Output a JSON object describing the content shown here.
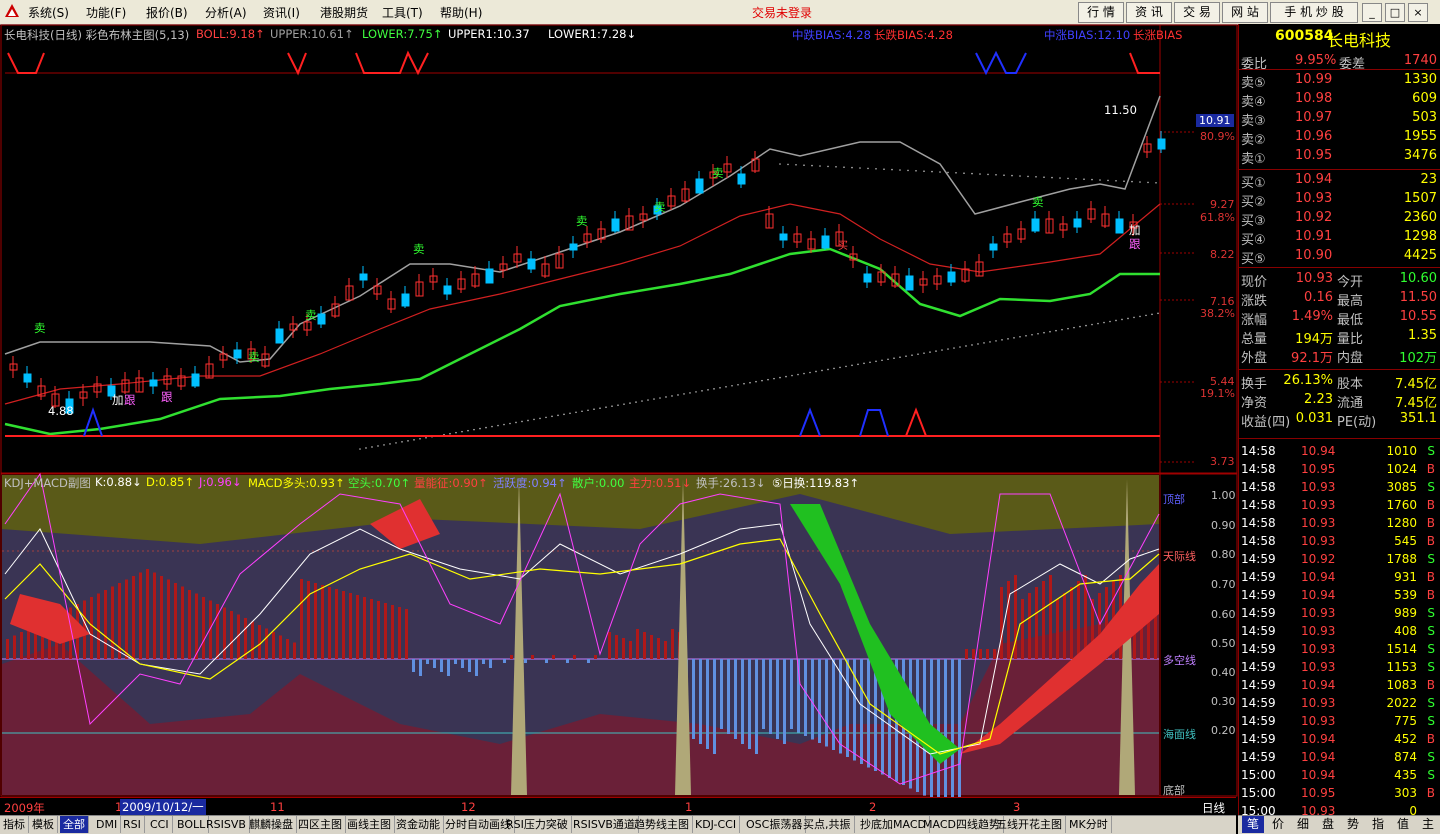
{
  "menu": {
    "items": [
      "系统(S)",
      "功能(F)",
      "报价(B)",
      "分析(A)",
      "资讯(I)",
      "港股期货",
      "工具(T)",
      "帮助(H)"
    ],
    "status": "交易未登录",
    "toolbar": [
      "行 情",
      "资 讯",
      "交 易",
      "网 站",
      "手 机 炒 股"
    ],
    "window_buttons": [
      "_",
      "□",
      "×"
    ]
  },
  "main_chart": {
    "header": [
      {
        "text": "长电科技(日线) 彩色布林主图(5,13)",
        "color": "#c0c0c0"
      },
      {
        "text": "BOLL:9.18↑",
        "color": "#ff4040"
      },
      {
        "text": "UPPER:10.61↑",
        "color": "#a0a0a0"
      },
      {
        "text": "LOWER:7.75↑",
        "color": "#40ff40"
      },
      {
        "text": "UPPER1:10.37",
        "color": "#ffffff"
      },
      {
        "text": "LOWER1:7.28↓",
        "color": "#ffffff"
      }
    ],
    "top_labels": [
      {
        "text": "中跌BIAS:4.28",
        "color": "#4040ff"
      },
      {
        "text": "长跌BIAS:4.28",
        "color": "#ff3030"
      },
      {
        "text": "中涨BIAS:12.10",
        "color": "#4040ff"
      },
      {
        "text": "长涨BIAS",
        "color": "#ff3030"
      }
    ],
    "price_axis": [
      "10.91",
      "80.9%",
      "9.27",
      "61.8%",
      "8.22",
      "7.16",
      "38.2%",
      "5.44",
      "19.1%",
      "3.73"
    ],
    "annotations": {
      "high": "11.50",
      "low": "4.88"
    },
    "signals": [
      "卖",
      "卖",
      "卖",
      "卖",
      "卖",
      "卖",
      "卖",
      "卖",
      "加",
      "跟",
      "跟",
      "加",
      "跟",
      "买"
    ]
  },
  "sub_chart": {
    "header": [
      {
        "text": "KDJ+MACD副图",
        "color": "#c0c0c0"
      },
      {
        "text": "K:0.88↓",
        "color": "#ffffff"
      },
      {
        "text": "D:0.85↑",
        "color": "#ffff00"
      },
      {
        "text": "J:0.96↓",
        "color": "#ff40ff"
      },
      {
        "text": "MACD多头:0.93↑",
        "color": "#ffff00"
      },
      {
        "text": "空头:0.70↑",
        "color": "#40ff40"
      },
      {
        "text": "量能征:0.90↑",
        "color": "#ff4040"
      },
      {
        "text": "活跃度:0.94↑",
        "color": "#8080ff"
      },
      {
        "text": "散户:0.00",
        "color": "#40ff40"
      },
      {
        "text": "主力:0.51↓",
        "color": "#ff4040"
      },
      {
        "text": "换手:26.13↓",
        "color": "#c0c0c0"
      },
      {
        "text": "⑤日换:119.83↑",
        "color": "#ffffff"
      }
    ],
    "axis": [
      "1.00",
      "0.90",
      "0.80",
      "0.70",
      "0.60",
      "0.50",
      "0.40",
      "0.30",
      "0.20"
    ],
    "zone_labels": [
      "顶部",
      "天际线",
      "多空线",
      "海面线",
      "底部"
    ]
  },
  "date_axis": {
    "labels": [
      "2009年",
      "1",
      "2009/10/12/一",
      "11",
      "12",
      "1",
      "2",
      "3"
    ],
    "period": "日线"
  },
  "quote": {
    "code": "600584",
    "name": "长电科技",
    "weibi": {
      "label": "委比",
      "value": "9.95%",
      "label2": "委差",
      "value2": "1740"
    },
    "asks": [
      {
        "label": "卖⑤",
        "price": "10.99",
        "vol": "1330"
      },
      {
        "label": "卖④",
        "price": "10.98",
        "vol": "609"
      },
      {
        "label": "卖③",
        "price": "10.97",
        "vol": "503"
      },
      {
        "label": "卖②",
        "price": "10.96",
        "vol": "1955"
      },
      {
        "label": "卖①",
        "price": "10.95",
        "vol": "3476"
      }
    ],
    "bids": [
      {
        "label": "买①",
        "price": "10.94",
        "vol": "23"
      },
      {
        "label": "买②",
        "price": "10.93",
        "vol": "1507"
      },
      {
        "label": "买③",
        "price": "10.92",
        "vol": "2360"
      },
      {
        "label": "买④",
        "price": "10.91",
        "vol": "1298"
      },
      {
        "label": "买⑤",
        "price": "10.90",
        "vol": "4425"
      }
    ],
    "stats1": [
      {
        "l1": "现价",
        "v1": "10.93",
        "l2": "今开",
        "v2": "10.60"
      },
      {
        "l1": "涨跌",
        "v1": "0.16",
        "l2": "最高",
        "v2": "11.50"
      },
      {
        "l1": "涨幅",
        "v1": "1.49%",
        "l2": "最低",
        "v2": "10.55"
      },
      {
        "l1": "总量",
        "v1": "194万",
        "l2": "量比",
        "v2": "1.35"
      },
      {
        "l1": "外盘",
        "v1": "92.1万",
        "l2": "内盘",
        "v2": "102万"
      }
    ],
    "stats2": [
      {
        "l1": "换手",
        "v1": "26.13%",
        "l2": "股本",
        "v2": "7.45亿"
      },
      {
        "l1": "净资",
        "v1": "2.23",
        "l2": "流通",
        "v2": "7.45亿"
      },
      {
        "l1": "收益(四)",
        "v1": "0.031",
        "l2": "PE(动)",
        "v2": "351.1"
      }
    ],
    "trades": [
      {
        "time": "14:58",
        "price": "10.94",
        "vol": "1010",
        "side": "S"
      },
      {
        "time": "14:58",
        "price": "10.95",
        "vol": "1024",
        "side": "B"
      },
      {
        "time": "14:58",
        "price": "10.93",
        "vol": "3085",
        "side": "S"
      },
      {
        "time": "14:58",
        "price": "10.93",
        "vol": "1760",
        "side": "B"
      },
      {
        "time": "14:58",
        "price": "10.93",
        "vol": "1280",
        "side": "B"
      },
      {
        "time": "14:58",
        "price": "10.93",
        "vol": "545",
        "side": "B"
      },
      {
        "time": "14:59",
        "price": "10.92",
        "vol": "1788",
        "side": "S"
      },
      {
        "time": "14:59",
        "price": "10.94",
        "vol": "931",
        "side": "B"
      },
      {
        "time": "14:59",
        "price": "10.94",
        "vol": "539",
        "side": "B"
      },
      {
        "time": "14:59",
        "price": "10.93",
        "vol": "989",
        "side": "S"
      },
      {
        "time": "14:59",
        "price": "10.93",
        "vol": "408",
        "side": "S"
      },
      {
        "time": "14:59",
        "price": "10.93",
        "vol": "1514",
        "side": "S"
      },
      {
        "time": "14:59",
        "price": "10.93",
        "vol": "1153",
        "side": "S"
      },
      {
        "time": "14:59",
        "price": "10.94",
        "vol": "1083",
        "side": "B"
      },
      {
        "time": "14:59",
        "price": "10.93",
        "vol": "2022",
        "side": "S"
      },
      {
        "time": "14:59",
        "price": "10.93",
        "vol": "775",
        "side": "S"
      },
      {
        "time": "14:59",
        "price": "10.94",
        "vol": "452",
        "side": "B"
      },
      {
        "time": "14:59",
        "price": "10.94",
        "vol": "874",
        "side": "S"
      },
      {
        "time": "15:00",
        "price": "10.94",
        "vol": "435",
        "side": "S"
      },
      {
        "time": "15:00",
        "price": "10.95",
        "vol": "303",
        "side": "B"
      },
      {
        "time": "15:00",
        "price": "10.93",
        "vol": "0",
        "side": ""
      }
    ]
  },
  "bottom_tabs": [
    "指标",
    "模板",
    "全部",
    "DMI",
    "RSI",
    "CCI",
    "BOLL",
    "RSISVB",
    "麒麟操盘",
    "四区主图",
    "画线主图",
    "资金动能",
    "分时自动画线",
    "RSI压力突破",
    "RSISVB通道",
    "趋势线主图",
    "KDJ-CCI",
    "OSC振荡器",
    "买点,共振",
    "抄底加MACD",
    "MACD四线趋势",
    "五线开花主图",
    "MK分时"
  ],
  "right_tabs": [
    "笔",
    "价",
    "细",
    "盘",
    "势",
    "指",
    "值",
    "主"
  ],
  "colors": {
    "up": "#ff3030",
    "down": "#00c0ff",
    "green": "#30ff30",
    "yellow": "#ffff00",
    "frame": "#a00000"
  }
}
